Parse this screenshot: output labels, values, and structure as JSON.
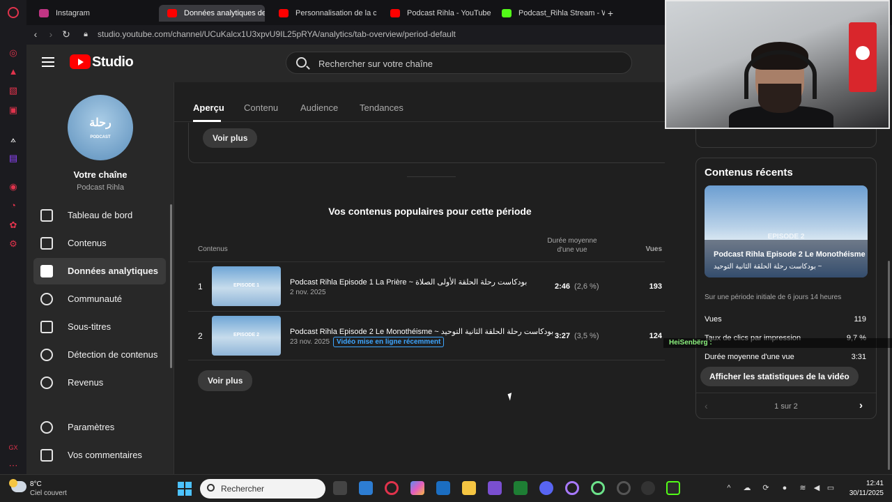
{
  "browser": {
    "tabs": [
      {
        "label": "Instagram",
        "color": "#c13584"
      },
      {
        "label": "Données analytiques de l",
        "color": "#ff0000"
      },
      {
        "label": "Personnalisation de la ch",
        "color": "#ff0000"
      },
      {
        "label": "Podcast Rihla - YouTube",
        "color": "#ff0000"
      },
      {
        "label": "Podcast_Rihla Stream - W",
        "color": "#53fc18"
      }
    ],
    "url": "studio.youtube.com/channel/UCuKalcx1U3xpvU9IL25pRYA/analytics/tab-overview/period-default"
  },
  "header": {
    "app_name": "Studio",
    "search_placeholder": "Rechercher sur votre chaîne"
  },
  "sidebar": {
    "avatar_logo_text": "رحلة",
    "avatar_logo_sub": "PODCAST",
    "channel_title": "Votre chaîne",
    "channel_name": "Podcast Rihla",
    "items": [
      {
        "label": "Tableau de bord"
      },
      {
        "label": "Contenus"
      },
      {
        "label": "Données analytiques"
      },
      {
        "label": "Communauté"
      },
      {
        "label": "Sous-titres"
      },
      {
        "label": "Détection de contenus"
      },
      {
        "label": "Revenus"
      },
      {
        "label": "Paramètres"
      },
      {
        "label": "Vos commentaires"
      }
    ]
  },
  "main": {
    "tabs": [
      {
        "label": "Aperçu"
      },
      {
        "label": "Contenu"
      },
      {
        "label": "Audience"
      },
      {
        "label": "Tendances"
      }
    ],
    "top_see_more": "Voir plus",
    "popular_title": "Vos contenus populaires pour cette période",
    "columns": {
      "content": "Contenus",
      "avg_duration": "Durée moyenne d'une vue",
      "views": "Vues"
    },
    "rows": [
      {
        "rank": "1",
        "thumb_label": "EPISODE 1",
        "title": "Podcast Rihla Episode 1 La Prière ~ بودكاست رحلة الحلقة الأولى الصلاة",
        "date": "2 nov. 2025",
        "badge": "",
        "avg": "2:46",
        "avg_pct": "(2,6 %)",
        "views": "193"
      },
      {
        "rank": "2",
        "thumb_label": "EPISODE 2",
        "title": "Podcast Rihla Episode 2 Le Monothéisme ~ بودكاست رحلة الحلقة الثانية التوحيد",
        "date": "23 nov. 2025",
        "badge": "Vidéo mise en ligne récemment",
        "avg": "3:27",
        "avg_pct": "(3,5 %)",
        "views": "124"
      }
    ],
    "bottom_see_more": "Voir plus"
  },
  "right_panel": {
    "prev_card_button": "Voir plus",
    "recent_title": "Contenus récents",
    "recent_video": {
      "episode_label": "EPISODE 2",
      "title": "Podcast Rihla Episode 2 Le Monothéisme",
      "subtitle": "بودكاست رحلة الحلقة الثانية التوحيد ~"
    },
    "period_note": "Sur une période initiale de 6 jours 14 heures",
    "stats": [
      {
        "label": "Vues",
        "value": "119"
      },
      {
        "label": "Taux de clics par impression",
        "value": "9,7 %"
      },
      {
        "label": "Durée moyenne d'une vue",
        "value": "3:31"
      }
    ],
    "stats_button": "Afficher les statistiques de la vidéo",
    "pager": "1 sur 2"
  },
  "overlay_chat": "HeiSenbërg :",
  "taskbar": {
    "temperature": "8°C",
    "weather": "Ciel couvert",
    "search_label": "Rechercher",
    "time": "12:41",
    "date": "30/11/2025"
  },
  "colors": {
    "youtube_red": "#ff0000",
    "accent_blue": "#3ea6ff",
    "opera_red": "#e0334c"
  }
}
